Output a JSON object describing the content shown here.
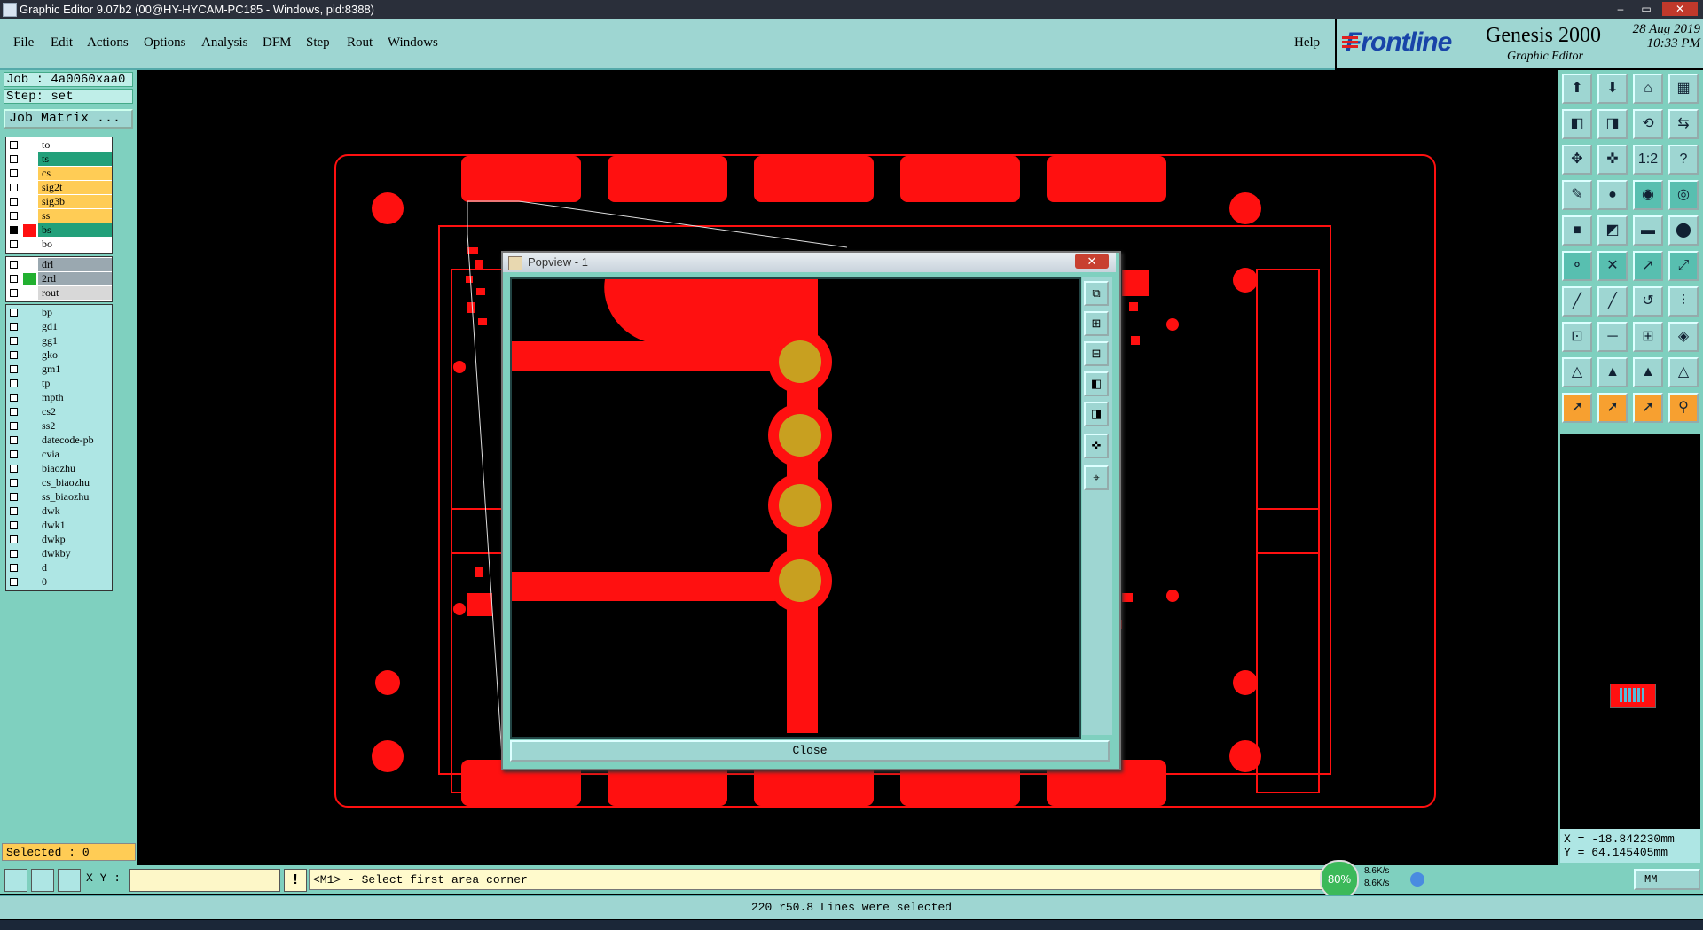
{
  "window": {
    "title": "Graphic Editor 9.07b2 (00@HY-HYCAM-PC185 - Windows, pid:8388)",
    "controls": [
      "–",
      "▭",
      "✕"
    ]
  },
  "menu": {
    "items": [
      "File",
      "Edit",
      "Actions",
      "Options",
      "Analysis",
      "DFM",
      "Step",
      "Rout",
      "Windows"
    ],
    "help": "Help"
  },
  "brand": {
    "logo": "Frontline",
    "product": "Genesis 2000",
    "subtitle": "Graphic Editor",
    "date": "28 Aug 2019",
    "time": "10:33 PM"
  },
  "job": {
    "job_line": "Job : 4a0060xaa0",
    "step_line": "Step: set",
    "matrix_button": "Job Matrix ..."
  },
  "layers": {
    "group1": [
      {
        "name": "to",
        "color": "#ffffff",
        "swatch": ""
      },
      {
        "name": "ts",
        "color": "#22a07a",
        "swatch": ""
      },
      {
        "name": "cs",
        "color": "#ffcc55",
        "swatch": ""
      },
      {
        "name": "sig2t",
        "color": "#ffcc55",
        "swatch": ""
      },
      {
        "name": "sig3b",
        "color": "#ffcc55",
        "swatch": ""
      },
      {
        "name": "ss",
        "color": "#ffcc55",
        "swatch": ""
      },
      {
        "name": "bs",
        "color": "#22a07a",
        "swatch": "#ff1010",
        "active": true
      },
      {
        "name": "bo",
        "color": "#ffffff",
        "swatch": ""
      }
    ],
    "group2": [
      {
        "name": "drl",
        "color": "#9aa8b0",
        "swatch": ""
      },
      {
        "name": "2rd",
        "color": "#9aa8b0",
        "swatch": "#22b030"
      },
      {
        "name": "rout",
        "color": "#d8d8d8",
        "swatch": ""
      }
    ],
    "group3": [
      {
        "name": "bp"
      },
      {
        "name": "gd1"
      },
      {
        "name": "gg1"
      },
      {
        "name": "gko"
      },
      {
        "name": "gm1"
      },
      {
        "name": "tp"
      },
      {
        "name": "mpth"
      },
      {
        "name": "cs2"
      },
      {
        "name": "ss2"
      },
      {
        "name": "datecode-pb"
      },
      {
        "name": "cvia"
      },
      {
        "name": "biaozhu"
      },
      {
        "name": "cs_biaozhu"
      },
      {
        "name": "ss_biaozhu"
      },
      {
        "name": "dwk"
      },
      {
        "name": "dwk1"
      },
      {
        "name": "dwkp"
      },
      {
        "name": "dwkby"
      },
      {
        "name": "d"
      },
      {
        "name": "0"
      }
    ]
  },
  "selected": "Selected : 0",
  "popview": {
    "title": "Popview - 1",
    "close_x": "✕",
    "close_button": "Close"
  },
  "coords": {
    "x": "X = -18.842230mm",
    "y": "Y = 64.145405mm"
  },
  "statusbar": {
    "xy_label": "X Y :",
    "xy_value": "",
    "prompt": "<M1> - Select first area corner",
    "message": "220 r50.8 Lines were selected",
    "units": "MM"
  },
  "network": {
    "percent": "80%",
    "up": "8.6K/s",
    "down": "8.6K/s"
  },
  "colors": {
    "pcb_red": "#ff1010",
    "pad_gold": "#c8a020",
    "panel_teal": "#7fd0bf",
    "brand_blue": "#1844a8"
  }
}
